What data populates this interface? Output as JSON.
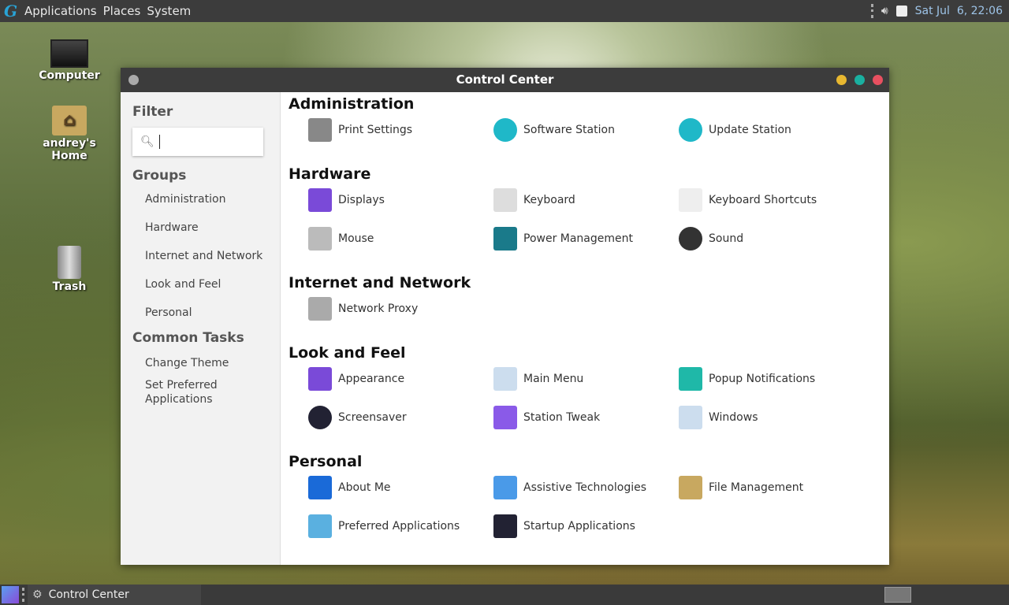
{
  "topbar": {
    "menus": [
      "Applications",
      "Places",
      "System"
    ],
    "clock": "Sat Jul  6, 22:06"
  },
  "desktop": {
    "icons": [
      "Computer",
      "andrey's Home",
      "Trash"
    ]
  },
  "window": {
    "title": "Control Center"
  },
  "sidebar": {
    "filter_label": "Filter",
    "search_value": "",
    "groups_label": "Groups",
    "groups": [
      "Administration",
      "Hardware",
      "Internet and Network",
      "Look and Feel",
      "Personal"
    ],
    "tasks_label": "Common Tasks",
    "tasks": [
      "Change Theme",
      "Set Preferred Applications"
    ]
  },
  "sections": [
    {
      "title": "Administration",
      "items": [
        {
          "label": "Print Settings",
          "icon": "printer-icon",
          "color": "#888"
        },
        {
          "label": "Software Station",
          "icon": "download-icon",
          "color": "#1fb8c8"
        },
        {
          "label": "Update Station",
          "icon": "upload-icon",
          "color": "#1fb8c8"
        }
      ]
    },
    {
      "title": "Hardware",
      "items": [
        {
          "label": "Displays",
          "icon": "display-icon",
          "color": "#7a4ad8"
        },
        {
          "label": "Keyboard",
          "icon": "keyboard-icon",
          "color": "#ddd"
        },
        {
          "label": "Keyboard Shortcuts",
          "icon": "ctrl-key-icon",
          "color": "#eee"
        },
        {
          "label": "Mouse",
          "icon": "mouse-icon",
          "color": "#bbb"
        },
        {
          "label": "Power Management",
          "icon": "power-icon",
          "color": "#1a7a8a"
        },
        {
          "label": "Sound",
          "icon": "speaker-icon",
          "color": "#333"
        }
      ]
    },
    {
      "title": "Internet and Network",
      "items": [
        {
          "label": "Network Proxy",
          "icon": "proxy-icon",
          "color": "#aaa"
        }
      ]
    },
    {
      "title": "Look and Feel",
      "items": [
        {
          "label": "Appearance",
          "icon": "appearance-icon",
          "color": "#7a4ad8"
        },
        {
          "label": "Main Menu",
          "icon": "menu-icon",
          "color": "#cde"
        },
        {
          "label": "Popup Notifications",
          "icon": "notification-icon",
          "color": "#1fb8a8"
        },
        {
          "label": "Screensaver",
          "icon": "screensaver-icon",
          "color": "#223"
        },
        {
          "label": "Station Tweak",
          "icon": "tweak-icon",
          "color": "#8a5ae8"
        },
        {
          "label": "Windows",
          "icon": "windows-icon",
          "color": "#cde"
        }
      ]
    },
    {
      "title": "Personal",
      "items": [
        {
          "label": "About Me",
          "icon": "info-icon",
          "color": "#1a6ad8"
        },
        {
          "label": "Assistive Technologies",
          "icon": "accessibility-icon",
          "color": "#4a9ae8"
        },
        {
          "label": "File Management",
          "icon": "folder-icon",
          "color": "#c8a860"
        },
        {
          "label": "Preferred Applications",
          "icon": "preferred-apps-icon",
          "color": "#5ab0e0"
        },
        {
          "label": "Startup Applications",
          "icon": "startup-icon",
          "color": "#223"
        }
      ]
    }
  ],
  "taskbar": {
    "task": "Control Center"
  }
}
